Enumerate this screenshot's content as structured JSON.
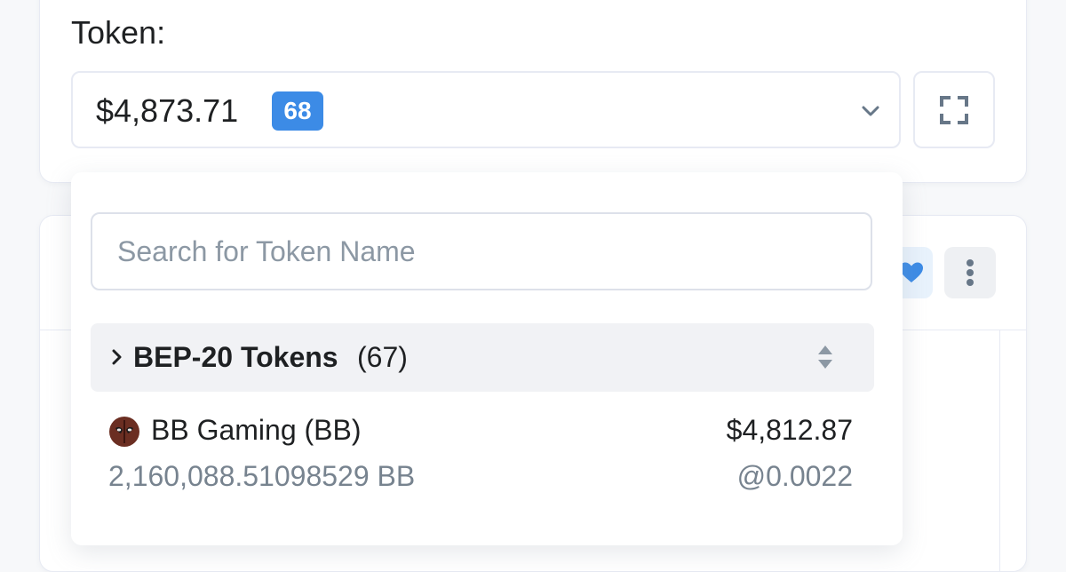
{
  "token_label": "Token:",
  "selector": {
    "value": "$4,873.71",
    "badge_count": "68"
  },
  "icons": {
    "dropdown": "chevron-down-icon",
    "expand": "expand-icon",
    "favorite": "heart-icon",
    "more": "more-vertical-icon"
  },
  "colors": {
    "badge": "#3c8be6",
    "heart": "#3c8be6"
  },
  "search": {
    "placeholder": "Search for Token Name",
    "value": ""
  },
  "token_group": {
    "title": "BEP-20 Tokens",
    "count": "(67)"
  },
  "tokens": [
    {
      "name": "BB Gaming (BB)",
      "value_usd": "$4,812.87",
      "quantity": "2,160,088.51098529 BB",
      "price": "@0.0022"
    }
  ]
}
